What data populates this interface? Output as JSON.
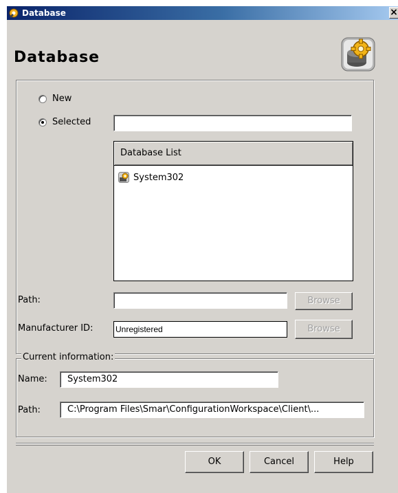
{
  "window": {
    "title": "Database",
    "close_glyph": "×"
  },
  "header": {
    "title": "Database",
    "icon": "database-gear-icon"
  },
  "source": {
    "new_label": "New",
    "selected_label": "Selected",
    "selected_option": "Selected",
    "selected_value": ""
  },
  "database_list": {
    "header": "Database List",
    "items": [
      {
        "label": "System302",
        "icon": "database-gear-icon"
      }
    ]
  },
  "path": {
    "label": "Path:",
    "value": "",
    "browse_label": "Browse"
  },
  "manufacturer": {
    "label": "Manufacturer ID:",
    "value": "Unregistered",
    "browse_label": "Browse"
  },
  "current_info": {
    "legend": "Current information:",
    "name_label": "Name:",
    "name_value": "System302",
    "path_label": "Path:",
    "path_value": "C:\\Program Files\\Smar\\ConfigurationWorkspace\\Client\\..."
  },
  "buttons": {
    "ok": "OK",
    "cancel": "Cancel",
    "help": "Help"
  },
  "colors": {
    "dialog_bg": "#d6d3ce",
    "title_gradient_start": "#0a246a",
    "title_gradient_end": "#a6caf0"
  }
}
